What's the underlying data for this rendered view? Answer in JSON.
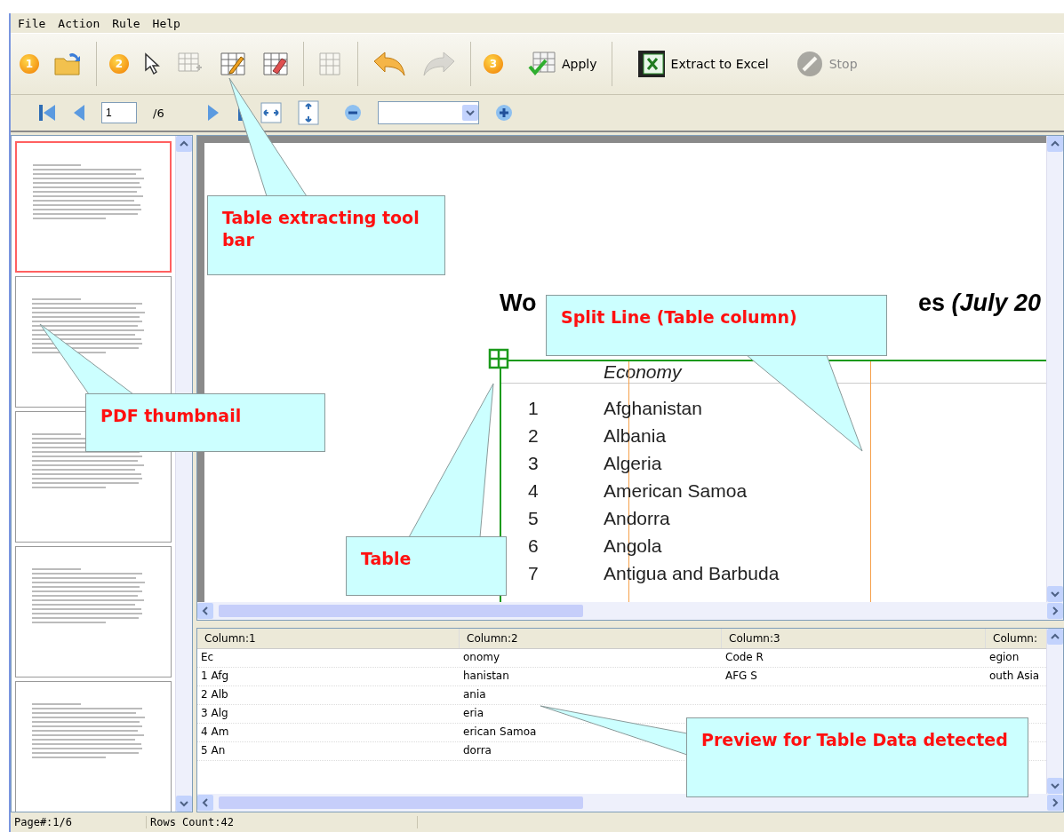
{
  "menu": [
    {
      "label": "File"
    },
    {
      "label": "Action"
    },
    {
      "label": "Rule"
    },
    {
      "label": "Help"
    }
  ],
  "toolbar": [
    {
      "kind": "step",
      "label": "1"
    },
    {
      "kind": "tool",
      "disabled": false
    },
    {
      "kind": "separator"
    },
    {
      "kind": "step",
      "label": "2"
    },
    {
      "kind": "tool",
      "disabled": false
    },
    {
      "kind": "tool",
      "disabled": true
    },
    {
      "kind": "tool",
      "disabled": false
    },
    {
      "kind": "tool",
      "disabled": false
    },
    {
      "kind": "separator"
    },
    {
      "kind": "tool",
      "disabled": true
    },
    {
      "kind": "separator"
    },
    {
      "kind": "tool",
      "disabled": false
    },
    {
      "kind": "tool",
      "disabled": true
    },
    {
      "kind": "separator"
    },
    {
      "kind": "step",
      "label": "3"
    },
    {
      "kind": "button",
      "label": "Apply",
      "disabled": false
    },
    {
      "kind": "separator"
    },
    {
      "kind": "button",
      "label": "Extract to Excel",
      "disabled": false
    },
    {
      "kind": "button",
      "label": "Stop",
      "disabled": true
    }
  ],
  "navbar": {
    "page_value": "1",
    "page_total": "/6"
  },
  "thumbnails": [
    {
      "selected": true
    },
    {
      "selected": false
    },
    {
      "selected": false
    },
    {
      "selected": false
    },
    {
      "selected": false
    }
  ],
  "document": {
    "title_start": "Wo",
    "title_end": "es",
    "title_italic": "(July 20",
    "header": "Economy",
    "rows": [
      {
        "number": "1",
        "name": "Afghanistan"
      },
      {
        "number": "2",
        "name": "Albania"
      },
      {
        "number": "3",
        "name": "Algeria"
      },
      {
        "number": "4",
        "name": "American Samoa"
      },
      {
        "number": "5",
        "name": "Andorra"
      },
      {
        "number": "6",
        "name": "Angola"
      },
      {
        "number": "7",
        "name": "Antigua and Barbuda"
      }
    ]
  },
  "preview": {
    "columns": [
      "Column:1",
      "Column:2",
      "Column:3",
      "Column:"
    ],
    "rows": [
      [
        "Ec",
        "onomy",
        "Code R",
        "egion"
      ],
      [
        "1 Afg",
        "hanistan",
        "AFG S",
        "outh Asia"
      ],
      [
        "2 Alb",
        "ania"
      ],
      [
        "3 Alg",
        "eria"
      ],
      [
        "4 Am",
        "erican Samoa"
      ],
      [
        "5 An",
        "dorra"
      ]
    ]
  },
  "status_bar": [
    "Page#:1/6",
    "Rows Count:42"
  ],
  "callouts": [
    {
      "text": "Table extracting tool bar"
    },
    {
      "text": "PDF thumbnail"
    },
    {
      "text": "Split Line (Table column)"
    },
    {
      "text": "Table"
    },
    {
      "text": "Preview for Table Data detected"
    }
  ]
}
